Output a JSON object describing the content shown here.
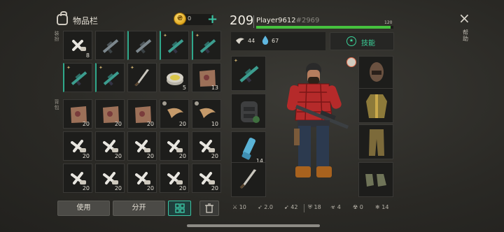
{
  "inventory": {
    "title": "物品栏",
    "coins": "0",
    "side_label_top": "装扮",
    "side_label_bottom": "背包",
    "row_quantities": [
      [
        "8",
        "",
        "",
        "",
        ""
      ],
      [
        "",
        "",
        "",
        "5",
        "13"
      ],
      [
        "20",
        "20",
        "20",
        "20",
        "10"
      ],
      [
        "20",
        "20",
        "20",
        "20",
        "20"
      ],
      [
        "20",
        "20",
        "20",
        "20",
        "20"
      ]
    ],
    "buttons": {
      "use": "使用",
      "split": "分开"
    }
  },
  "player": {
    "level": "209",
    "name": "Player9612",
    "tag": "#2969",
    "xp_max": "120",
    "xp_fraction": 0.98,
    "hunger": "44",
    "thirst": "67",
    "skills_label": "技能"
  },
  "equipment": {
    "left_quantities": [
      "",
      "",
      "14",
      ""
    ]
  },
  "close_label": "×",
  "side_help": "帮助",
  "bottom_stats": {
    "damage": "10",
    "speed": "2.0",
    "armor_pierce": "42",
    "defense": "18",
    "bio": "4",
    "rad": "0",
    "cold": "14"
  }
}
